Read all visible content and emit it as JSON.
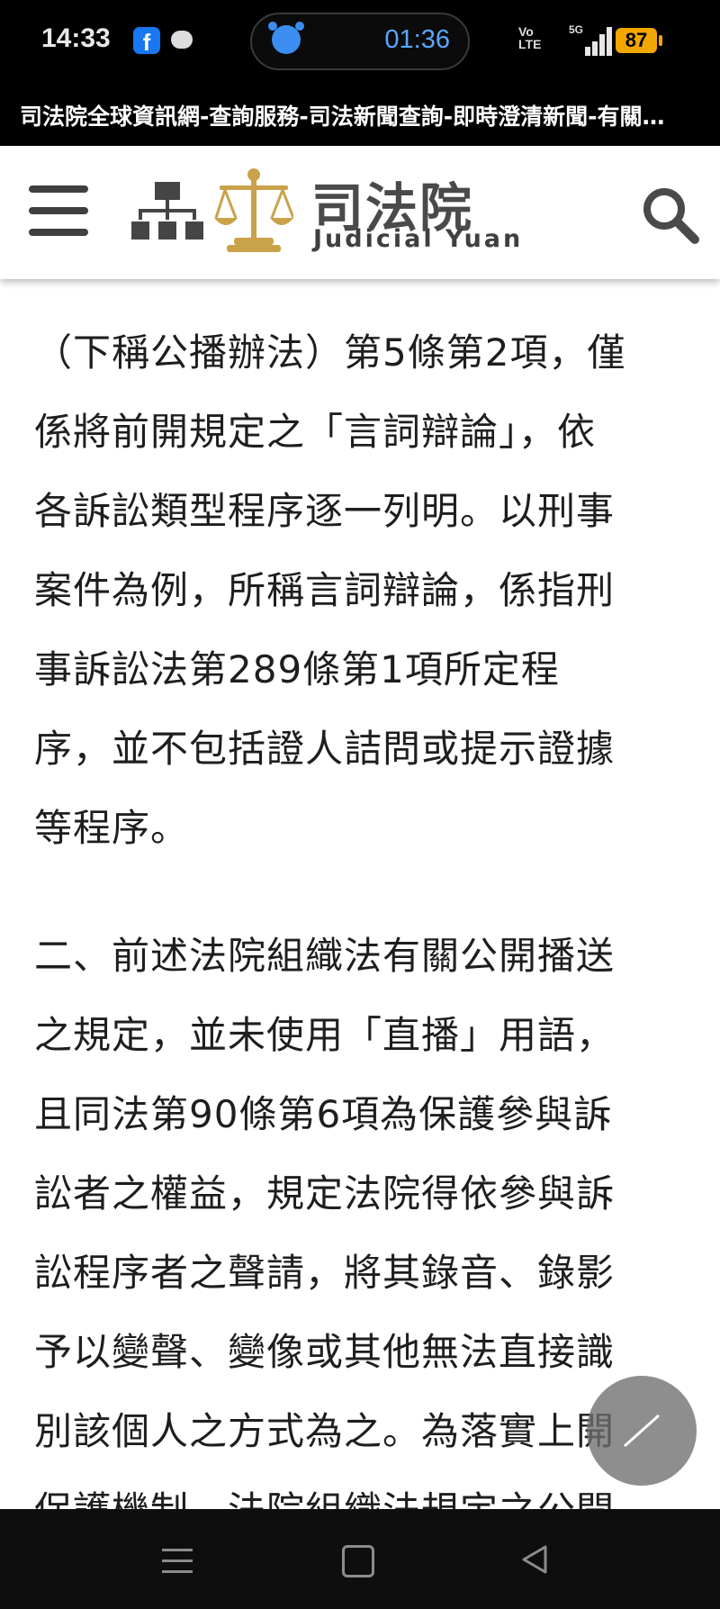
{
  "status_bar": {
    "time": "14:33",
    "facebook_letter": "f",
    "alarm_timer": "01:36",
    "network_label": "Vo\nLTE",
    "network_type": "5G",
    "battery": "87"
  },
  "browser": {
    "page_title": "司法院全球資訊網-查詢服務-司法新聞查詢-即時澄清新聞-有關…"
  },
  "header": {
    "logo_name": "司法院",
    "logo_english": "Judicial Yuan",
    "icons": [
      "menu-icon",
      "sitemap-icon",
      "scales-of-justice-icon",
      "search-icon"
    ]
  },
  "article": {
    "lines": [
      "（下稱公播辦法）第5條第2項，僅",
      "係將前開規定之「言詞辯論」，依",
      "各訴訟類型程序逐一列明。以刑事",
      "案件為例，所稱言詞辯論，係指刑",
      "事訴訟法第289條第1項所定程",
      "序，並不包括證人詰問或提示證據",
      "等程序。",
      "",
      "二、前述法院組織法有關公開播送",
      "之規定，並未使用「直播」用語，",
      "且同法第90條第6項為保護參與訴",
      "訟者之權益，規定法院得依參與訴",
      "訟程序者之聲請，將其錄音、錄影",
      "予以變聲、變像或其他無法直接識",
      "別該個人之方式為之。為落實上開",
      "保護機制，法院組織法規定之公開"
    ]
  },
  "theme": {
    "status_bar_bg": "#000000",
    "accent_blue": "#3b8ef0",
    "battery_color": "#f2a600",
    "logo_gold": "#c9a24a",
    "text_color": "#1e1e1e"
  }
}
